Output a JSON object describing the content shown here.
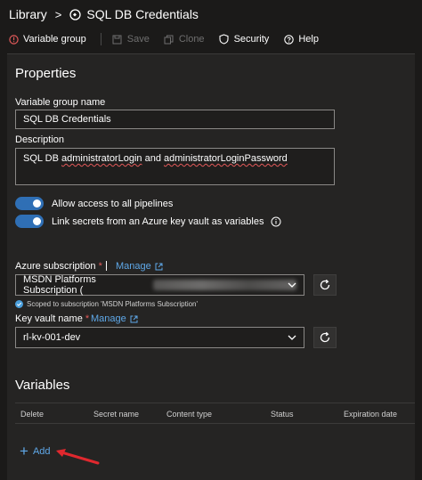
{
  "header": {
    "breadcrumb_root": "Library",
    "separator": ">",
    "title": "SQL DB Credentials"
  },
  "toolbar": {
    "variable_group": "Variable group",
    "save": "Save",
    "clone": "Clone",
    "security": "Security",
    "help": "Help"
  },
  "properties": {
    "title": "Properties",
    "name_label": "Variable group name",
    "name_value": "SQL DB Credentials",
    "description_label": "Description",
    "description_word1": "SQL DB",
    "description_word2": "administratorLogin",
    "description_word3": "and",
    "description_word4": "administratorLoginPassword",
    "toggle1_label": "Allow access to all pipelines",
    "toggle2_label": "Link secrets from an Azure key vault as variables"
  },
  "azure": {
    "subscription_label": "Azure subscription",
    "required_marker": "*",
    "manage_link": "Manage",
    "subscription_value": "MSDN Platforms Subscription (",
    "scoped_note": "Scoped to subscription 'MSDN Platforms Subscription'",
    "keyvault_label": "Key vault name",
    "keyvault_manage_link": "Manage",
    "keyvault_value": "rl-kv-001-dev"
  },
  "variables": {
    "title": "Variables",
    "columns": [
      "Delete",
      "Secret name",
      "Content type",
      "Status",
      "Expiration date"
    ],
    "add_label": "Add"
  },
  "colors": {
    "background": "#1b1a19",
    "panel": "#252423",
    "accent_blue": "#2f6fb5",
    "link_blue": "#5fa8e8",
    "required_red": "#e35a5a",
    "arrow_red": "#e0282e"
  }
}
